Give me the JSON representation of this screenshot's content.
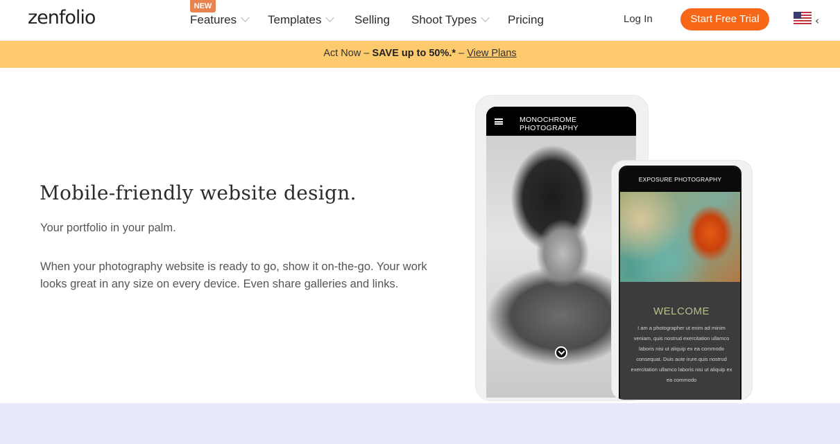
{
  "header": {
    "logo_text": "zenfolio",
    "new_badge": "NEW",
    "nav": [
      {
        "label": "Features",
        "has_dropdown": true
      },
      {
        "label": "Templates",
        "has_dropdown": true
      },
      {
        "label": "Selling",
        "has_dropdown": false
      },
      {
        "label": "Shoot Types",
        "has_dropdown": true
      },
      {
        "label": "Pricing",
        "has_dropdown": false
      }
    ],
    "login_label": "Log In",
    "cta_label": "Start Free Trial",
    "cta_color": "#f66717",
    "locale_icon": "us-flag-icon"
  },
  "banner": {
    "prefix": "Act Now –",
    "bold": "SAVE up to 50%.*",
    "separator": "–",
    "link": "View Plans",
    "background": "#fdcb6e"
  },
  "main": {
    "heading": "Mobile-friendly website design.",
    "subheading": "Your portfolio in your palm.",
    "body": "When your photography website is ready to go, show it on-the-go. Your work looks great in any size on every device. Even share galleries and links."
  },
  "phones": {
    "phone1": {
      "title": "MONOCHROME PHOTOGRAPHY"
    },
    "phone2": {
      "title": "EXPOSURE PHOTOGRAPHY",
      "welcome": "WELCOME",
      "lorem": "I am a photographer ut enim ad minim veniam, quis nostrud exercitation ullamco laboris nisi ut aliquip ex ea commodo consequat. Duis aute irure.quis nostrud exercitation ullamco laboris nisi ut aliquip ex ea commodo"
    }
  }
}
